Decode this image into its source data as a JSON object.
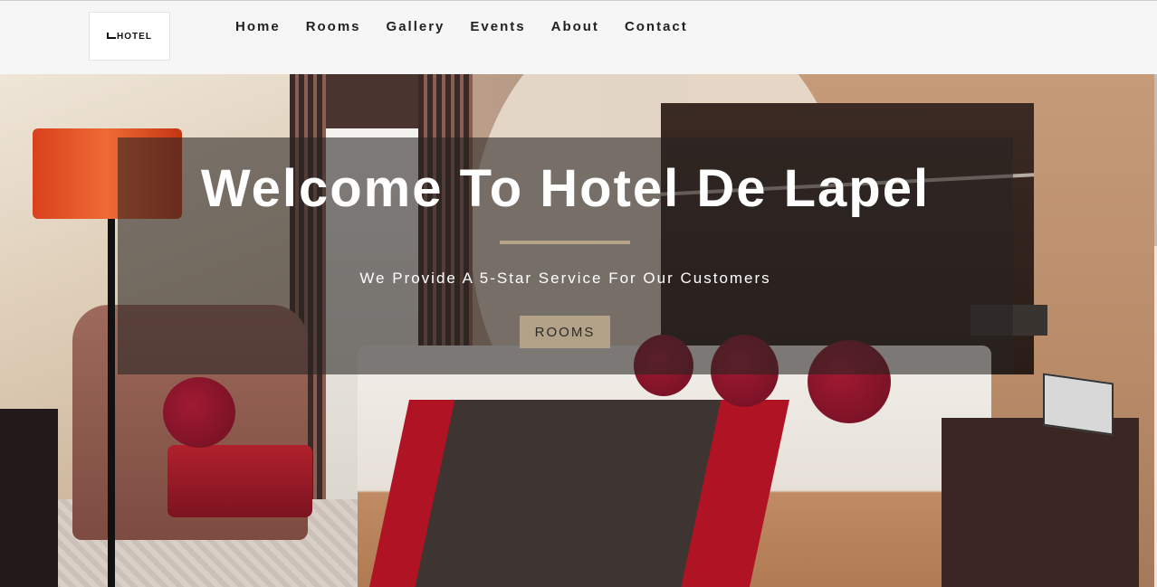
{
  "header": {
    "logo_text": "HOTEL",
    "nav": [
      "Home",
      "Rooms",
      "Gallery",
      "Events",
      "About",
      "Contact"
    ]
  },
  "hero": {
    "title": "Welcome To Hotel De Lapel",
    "subtitle": "We Provide A 5-Star Service For Our Customers",
    "button_label": "ROOMS",
    "background_image": "hotel bedroom with bed, red pillows, orange floor lamp and armchair"
  },
  "colors": {
    "navbar_bg": "#f6f6f6",
    "accent": "#b3a287",
    "overlay": "rgba(40,36,34,0.58)",
    "text_light": "#ffffff"
  }
}
